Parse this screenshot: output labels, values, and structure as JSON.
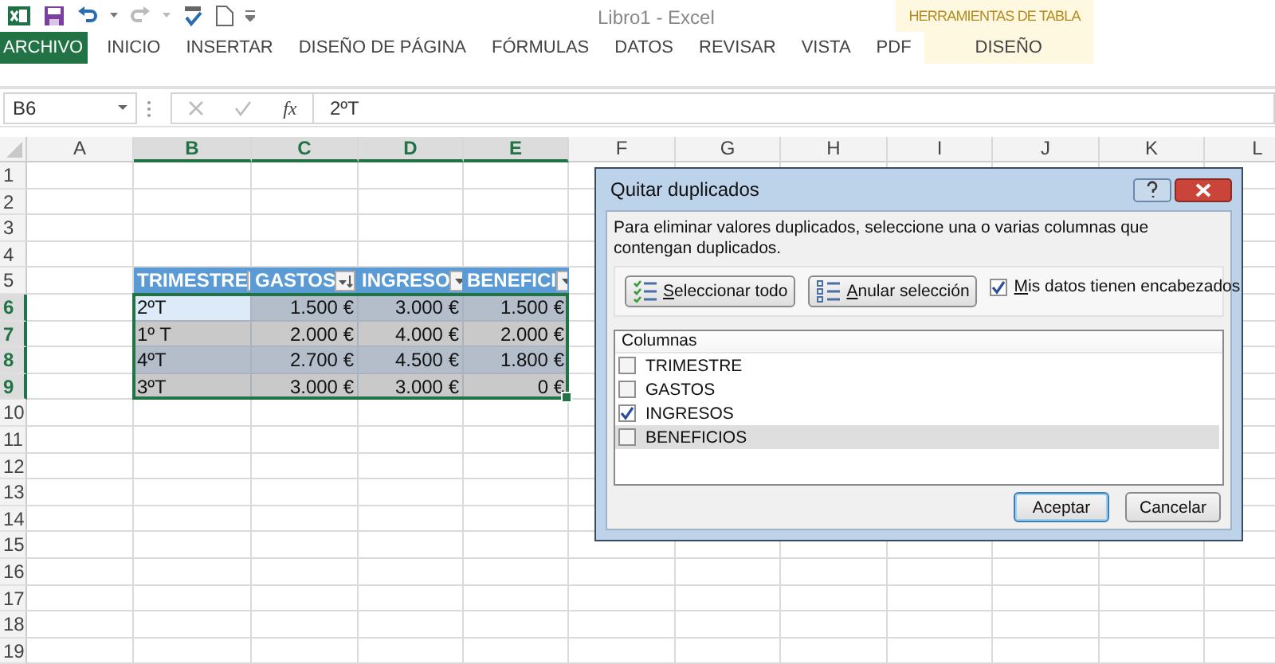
{
  "title_bar": {
    "title": "Libro1 - Excel"
  },
  "context_group": {
    "label": "HERRAMIENTAS DE TABLA"
  },
  "ribbon_tabs": [
    {
      "label": "ARCHIVO",
      "kind": "file"
    },
    {
      "label": "INICIO",
      "kind": "normal"
    },
    {
      "label": "INSERTAR",
      "kind": "normal"
    },
    {
      "label": "DISEÑO DE PÁGINA",
      "kind": "normal"
    },
    {
      "label": "FÓRMULAS",
      "kind": "normal"
    },
    {
      "label": "DATOS",
      "kind": "normal"
    },
    {
      "label": "REVISAR",
      "kind": "normal"
    },
    {
      "label": "VISTA",
      "kind": "normal"
    },
    {
      "label": "PDF",
      "kind": "normal"
    },
    {
      "label": "DISEÑO",
      "kind": "contextual"
    }
  ],
  "formula_bar": {
    "name_box": "B6",
    "function_label": "fx",
    "value": "2ºT"
  },
  "sheet": {
    "columns": [
      {
        "label": "A",
        "selected": false
      },
      {
        "label": "B",
        "selected": true
      },
      {
        "label": "C",
        "selected": true
      },
      {
        "label": "D",
        "selected": true
      },
      {
        "label": "E",
        "selected": true
      },
      {
        "label": "F",
        "selected": false
      },
      {
        "label": "G",
        "selected": false
      },
      {
        "label": "H",
        "selected": false
      },
      {
        "label": "I",
        "selected": false
      },
      {
        "label": "J",
        "selected": false
      },
      {
        "label": "K",
        "selected": false
      },
      {
        "label": "L",
        "selected": false
      }
    ],
    "rows": [
      {
        "label": "1",
        "selected": false
      },
      {
        "label": "2",
        "selected": false
      },
      {
        "label": "3",
        "selected": false
      },
      {
        "label": "4",
        "selected": false
      },
      {
        "label": "5",
        "selected": false
      },
      {
        "label": "6",
        "selected": true
      },
      {
        "label": "7",
        "selected": true
      },
      {
        "label": "8",
        "selected": true
      },
      {
        "label": "9",
        "selected": true
      },
      {
        "label": "10",
        "selected": false
      },
      {
        "label": "11",
        "selected": false
      },
      {
        "label": "12",
        "selected": false
      },
      {
        "label": "13",
        "selected": false
      },
      {
        "label": "14",
        "selected": false
      },
      {
        "label": "15",
        "selected": false
      },
      {
        "label": "16",
        "selected": false
      },
      {
        "label": "17",
        "selected": false
      },
      {
        "label": "18",
        "selected": false
      },
      {
        "label": "19",
        "selected": false
      }
    ]
  },
  "table": {
    "headers": [
      {
        "label": "TRIMESTRE",
        "kind": "filter"
      },
      {
        "label": "GASTOS",
        "kind": "sorted"
      },
      {
        "label": "INGRESO",
        "kind": "filter"
      },
      {
        "label": "BENEFICI",
        "kind": "filter"
      }
    ],
    "rows": [
      {
        "banded": true,
        "cells": [
          {
            "text": "2ºT",
            "active": true
          },
          {
            "text": "1.500 €",
            "active": false
          },
          {
            "text": "3.000 €",
            "active": false
          },
          {
            "text": "1.500 €",
            "active": false
          }
        ]
      },
      {
        "banded": false,
        "cells": [
          {
            "text": "1º T",
            "active": false
          },
          {
            "text": "2.000 €",
            "active": false
          },
          {
            "text": "4.000 €",
            "active": false
          },
          {
            "text": "2.000 €",
            "active": false
          }
        ]
      },
      {
        "banded": true,
        "cells": [
          {
            "text": "4ºT",
            "active": false
          },
          {
            "text": "2.700 €",
            "active": false
          },
          {
            "text": "4.500 €",
            "active": false
          },
          {
            "text": "1.800 €",
            "active": false
          }
        ]
      },
      {
        "banded": false,
        "cells": [
          {
            "text": "3ºT",
            "active": false
          },
          {
            "text": "3.000 €",
            "active": false
          },
          {
            "text": "3.000 €",
            "active": false
          },
          {
            "text": "0 €",
            "active": false
          }
        ]
      }
    ]
  },
  "dialog": {
    "title": "Quitar duplicados",
    "description": "Para eliminar valores duplicados, seleccione una o varias columnas que contengan duplicados.",
    "select_all": "Seleccionar todo",
    "unselect_all": "Anular selección",
    "headers_checkbox": {
      "label": "Mis datos tienen encabezados",
      "checked": true
    },
    "list_header": "Columnas",
    "columns": [
      {
        "label": "TRIMESTRE",
        "checked": false,
        "selected": false
      },
      {
        "label": "GASTOS",
        "checked": false,
        "selected": false
      },
      {
        "label": "INGRESOS",
        "checked": true,
        "selected": false
      },
      {
        "label": "BENEFICIOS",
        "checked": false,
        "selected": true
      }
    ],
    "buttons": [
      {
        "label": "Aceptar",
        "kind": "default"
      },
      {
        "label": "Cancelar",
        "kind": "normal"
      }
    ]
  }
}
